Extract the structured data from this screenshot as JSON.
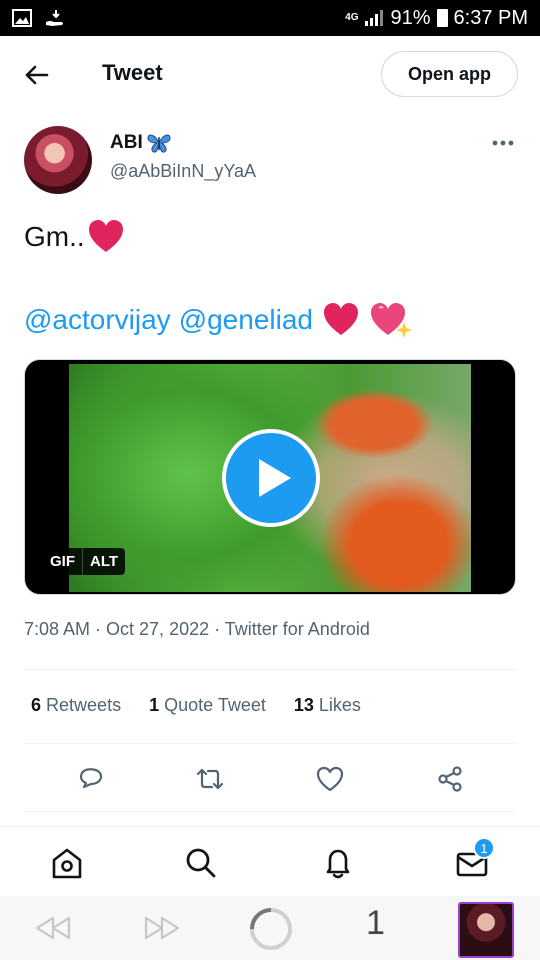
{
  "status_bar": {
    "network": "4G",
    "battery": "91%",
    "time": "6:37 PM"
  },
  "header": {
    "title": "Tweet",
    "open_app": "Open app"
  },
  "author": {
    "name": "ABI",
    "handle": "@aAbBiInN_yYaA"
  },
  "tweet": {
    "line1": "Gm..",
    "mention1": "@actorvijay",
    "mention2": "@geneliad",
    "media_badges": [
      "GIF",
      "ALT"
    ],
    "meta": "7:08 AM · Oct 27, 2022 · Twitter for Android"
  },
  "stats": {
    "retweets_count": "6",
    "retweets_label": "Retweets",
    "quotes_count": "1",
    "quotes_label": "Quote Tweet",
    "likes_count": "13",
    "likes_label": "Likes"
  },
  "bottom_nav": {
    "notification_badge": "1"
  },
  "browser": {
    "tab_count": "1"
  },
  "colors": {
    "accent": "#1d9bf0",
    "text": "#0f1419",
    "secondary": "#536471",
    "heart": "#e0245e"
  }
}
